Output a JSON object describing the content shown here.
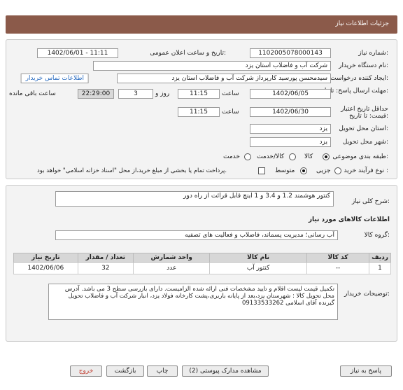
{
  "header": {
    "title": "جزئیات اطلاعات نیاز"
  },
  "form": {
    "need_number_label": "شماره نیاز:",
    "need_number": "1102005078000143",
    "announce_label": "تاریخ و ساعت اعلان عمومی:",
    "announce_value": "1402/06/01 - 11:11",
    "buyer_org_label": "نام دستگاه خریدار:",
    "buyer_org": "شرکت آب و فاضلاب استان یزد",
    "creator_label": "ایجاد کننده درخواست:",
    "creator": "سیدمحسن پورسید کارپرداز شرکت آب و فاضلاب استان یزد",
    "contact_link": "اطلاعات تماس خریدار",
    "deadline_label": "مهلت ارسال پاسخ: تا تاریخ:",
    "deadline_date": "1402/06/05",
    "time_label": "ساعت",
    "deadline_time": "11:15",
    "days_value": "3",
    "days_label": "روز و",
    "remaining_time": "22:29:00",
    "remaining_label": "ساعت باقی مانده",
    "validity_label": "حداقل تاریخ اعتبار قیمت: تا تاریخ:",
    "validity_date": "1402/06/30",
    "validity_time": "11:15",
    "province_label": "استان محل تحویل:",
    "province": "یزد",
    "city_label": "شهر محل تحویل:",
    "city": "یزد",
    "category_label": "طبقه بندی موضوعی:",
    "category_options": [
      "کالا",
      "کالا/خدمت",
      "خدمت"
    ],
    "process_label": "نوع فرآیند خرید :",
    "process_options": [
      "جزیی",
      "متوسط"
    ],
    "payment_note": "پرداخت تمام یا بخشی از مبلغ خرید،از محل \"اسناد خزانه اسلامی\" خواهد بود."
  },
  "details": {
    "summary_label": "شرح کلی نیاز:",
    "summary": "کنتور هوشمند 1.2 و 3.4 و 1 اینچ قابل قرائت از راه دور",
    "goods_info_title": "اطلاعات کالاهای مورد نیاز",
    "group_label": "گروه کالا:",
    "group": "آب رسانی؛ مدیریت پسماند، فاضلاب و فعالیت های تصفیه",
    "table": {
      "headers": [
        "ردیف",
        "کد کالا",
        "نام کالا",
        "واحد شمارش",
        "تعداد / مقدار",
        "تاریخ نیاز"
      ],
      "rows": [
        [
          "1",
          "--",
          "کنتور آب",
          "عدد",
          "32",
          "1402/06/06"
        ]
      ]
    },
    "notes_label": "توضیحات خریدار:",
    "notes": "تکمیل قیمت لیست اقلام و تایید مشخصات فنی ارائه شده الزامیست. دارای بازرسی سطح 3 می باشد. آدرس محل تحویل کالا : شهرستان یزد،بعد از پایانه باربری،پشت کارخانه فولاد یزد، انبار شرکت آب و فاضلاب تحویل گیرنده آقای اسلامی 09133533262"
  },
  "buttons": {
    "reply": "پاسخ به نیاز",
    "attachments": "مشاهده مدارک پیوستی (2)",
    "print": "چاپ",
    "back": "بازگشت",
    "exit": "خروج"
  },
  "colors": {
    "header_bg": "#8b5a4a",
    "link": "#2a6cc0",
    "exit_text": "#c0392b"
  }
}
